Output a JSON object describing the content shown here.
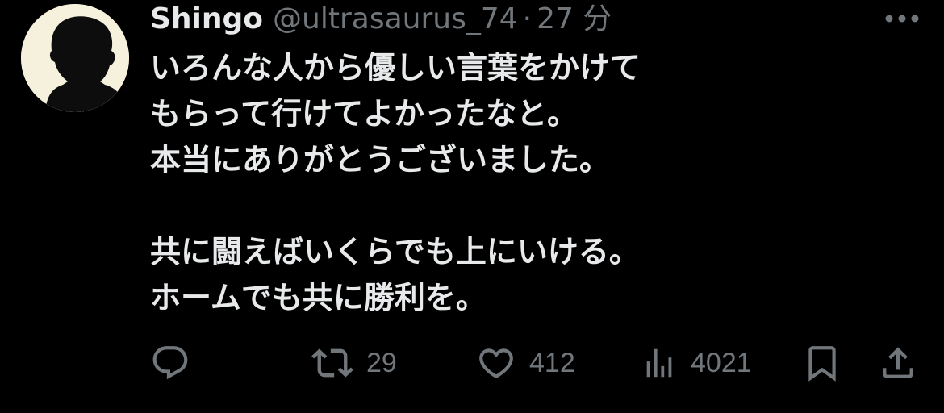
{
  "tweet": {
    "author": {
      "display_name": "Shingo",
      "handle": "@ultrasaurus_74",
      "separator": "·",
      "time": "27 分"
    },
    "text_lines_block1": [
      "いろんな人から優しい言葉をかけて",
      "もらって行けてよかったなと。",
      "本当にありがとうございました。"
    ],
    "text_lines_block2": [
      "共に闘えばいくらでも上にいける。",
      "ホームでも共に勝利を。"
    ],
    "actions": {
      "reply": {
        "icon": "reply-icon",
        "count": ""
      },
      "repost": {
        "icon": "repost-icon",
        "count": "29"
      },
      "like": {
        "icon": "heart-icon",
        "count": "412"
      },
      "views": {
        "icon": "views-icon",
        "count": "4021"
      },
      "bookmark": {
        "icon": "bookmark-icon"
      },
      "share": {
        "icon": "share-icon"
      }
    }
  },
  "colors": {
    "background": "#000000",
    "primary_text": "#e7e9ea",
    "secondary_text": "#71767b",
    "avatar_bg": "#f6f1dc"
  }
}
